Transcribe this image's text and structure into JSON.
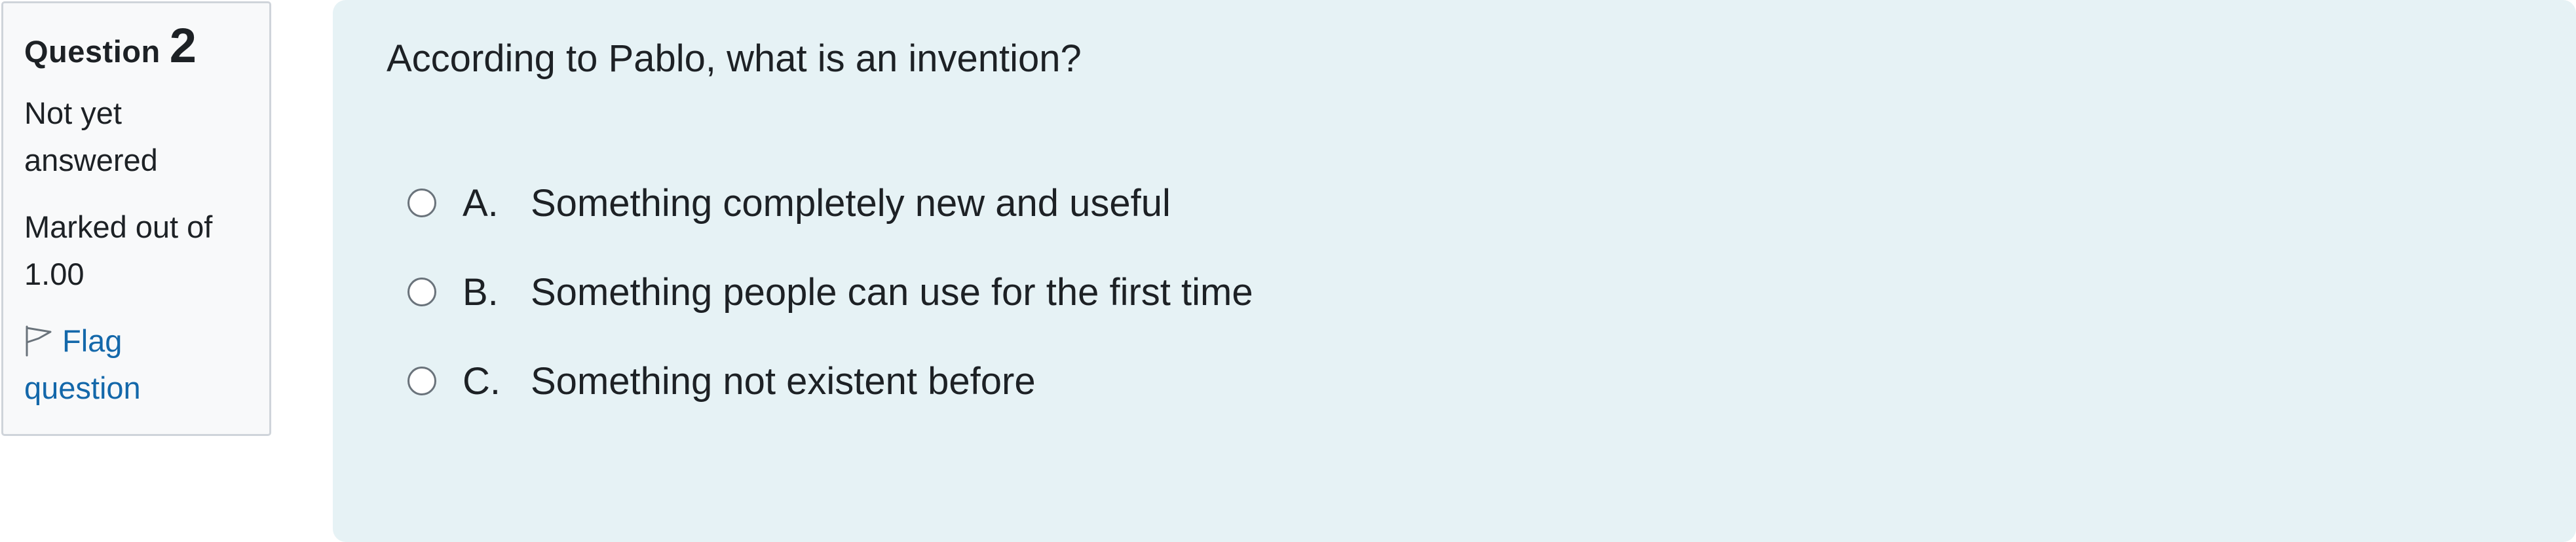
{
  "info": {
    "question_word": "Question",
    "question_number": "2",
    "state_line1": "Not yet",
    "state_line2": "answered",
    "mark_line1": "Marked out of",
    "mark_line2": "1.00",
    "flag_line1": "Flag",
    "flag_line2": "question"
  },
  "question": {
    "text": "According to Pablo, what is an invention?",
    "answers": [
      {
        "letter": "A.",
        "text": "Something completely new and useful"
      },
      {
        "letter": "B.",
        "text": "Something people can use for the first time"
      },
      {
        "letter": "C.",
        "text": "Something not existent before"
      }
    ]
  },
  "colors": {
    "link": "#1468aa",
    "panel_bg": "#e6f2f5",
    "info_bg": "#f8f9fa"
  },
  "icons": {
    "flag": "flag-icon",
    "radio": "radio-unchecked"
  }
}
